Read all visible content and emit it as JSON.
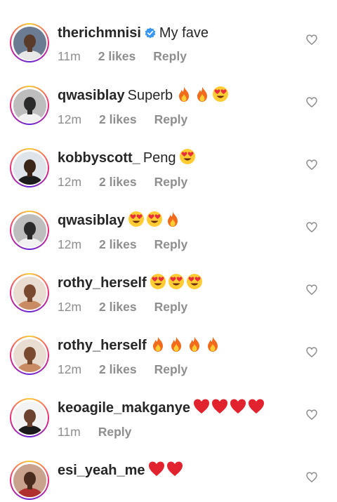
{
  "comments": [
    {
      "username": "therichmnisi",
      "verified": true,
      "text": "My fave",
      "emojis": [],
      "time": "11m",
      "likes": "2 likes",
      "reply": "Reply",
      "avatar": {
        "bg": "#6b7c92",
        "skin": "#5a3a28",
        "shirt": "#e8e8e8"
      }
    },
    {
      "username": "qwasiblay",
      "verified": false,
      "text": "Superb",
      "emojis": [
        "fire",
        "fire",
        "heart-eyes"
      ],
      "time": "12m",
      "likes": "2 likes",
      "reply": "Reply",
      "avatar": {
        "bg": "#bdbdbd",
        "skin": "#2b2b2b",
        "shirt": "#f2f2f2"
      }
    },
    {
      "username": "kobbyscott_",
      "verified": false,
      "text": "Peng",
      "emojis": [
        "heart-eyes"
      ],
      "time": "12m",
      "likes": "2 likes",
      "reply": "Reply",
      "avatar": {
        "bg": "#dfe3ea",
        "skin": "#3b2519",
        "shirt": "#1c1c1c"
      }
    },
    {
      "username": "qwasiblay",
      "verified": false,
      "text": "",
      "emojis": [
        "heart-eyes",
        "heart-eyes",
        "fire"
      ],
      "time": "12m",
      "likes": "2 likes",
      "reply": "Reply",
      "avatar": {
        "bg": "#bdbdbd",
        "skin": "#2b2b2b",
        "shirt": "#f2f2f2"
      }
    },
    {
      "username": "rothy_herself",
      "verified": false,
      "text": "",
      "emojis": [
        "heart-eyes",
        "heart-eyes",
        "heart-eyes"
      ],
      "time": "12m",
      "likes": "2 likes",
      "reply": "Reply",
      "avatar": {
        "bg": "#e9ddd2",
        "skin": "#7a4a30",
        "shirt": "#c98b63"
      }
    },
    {
      "username": "rothy_herself",
      "verified": false,
      "text": "",
      "emojis": [
        "fire",
        "fire",
        "fire",
        "fire"
      ],
      "time": "12m",
      "likes": "2 likes",
      "reply": "Reply",
      "avatar": {
        "bg": "#e9ddd2",
        "skin": "#7a4a30",
        "shirt": "#c98b63"
      }
    },
    {
      "username": "keoagile_makganye",
      "verified": false,
      "text": "",
      "emojis": [
        "red-heart",
        "red-heart",
        "red-heart",
        "red-heart"
      ],
      "time": "11m",
      "likes": "",
      "reply": "Reply",
      "avatar": {
        "bg": "#f3f3f3",
        "skin": "#6b4330",
        "shirt": "#1a1a1a"
      }
    },
    {
      "username": "esi_yeah_me",
      "verified": false,
      "text": "",
      "emojis": [
        "red-heart",
        "red-heart"
      ],
      "time": "",
      "likes": "",
      "reply": "",
      "avatar": {
        "bg": "#c8a28c",
        "skin": "#4a2c1e",
        "shirt": "#b03030"
      }
    }
  ],
  "colors": {
    "text": "#262626",
    "meta": "#8e8e8e",
    "verified": "#3897f0",
    "heart_icon": "#8e8e8e"
  }
}
